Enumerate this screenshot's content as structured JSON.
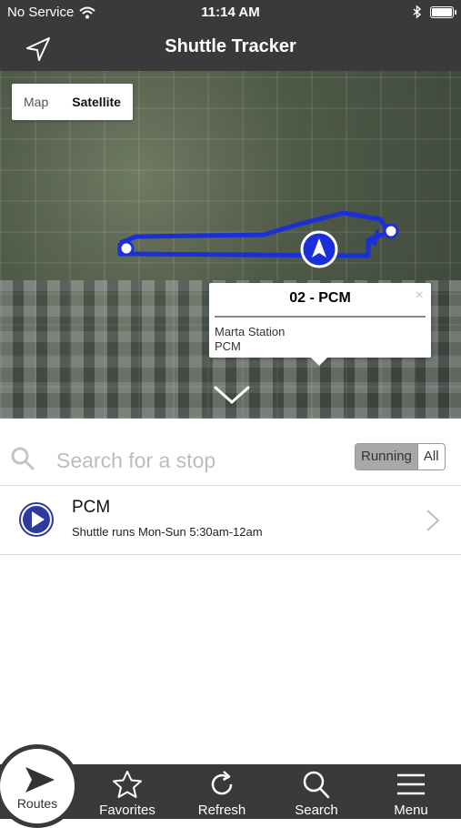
{
  "status_bar": {
    "carrier": "No Service",
    "time": "11:14 AM"
  },
  "nav": {
    "title": "Shuttle Tracker"
  },
  "map": {
    "type_options": [
      "Map",
      "Satellite"
    ],
    "selected_type": "Satellite",
    "route_color": "#1a2fd8",
    "popup": {
      "title": "02 - PCM",
      "close": "×",
      "line1": "Marta Station",
      "line2": "PCM"
    }
  },
  "search": {
    "placeholder": "Search for a stop",
    "filter_options": [
      "Running",
      "All"
    ],
    "selected_filter": "Running"
  },
  "routes": [
    {
      "name": "PCM",
      "description": "Shuttle runs Mon-Sun 5:30am-12am",
      "icon": "play-circle-icon",
      "icon_color": "#2f3a9e"
    }
  ],
  "tab_bar": {
    "routes": "Routes",
    "favorites": "Favorites",
    "refresh": "Refresh",
    "search": "Search",
    "menu": "Menu"
  }
}
